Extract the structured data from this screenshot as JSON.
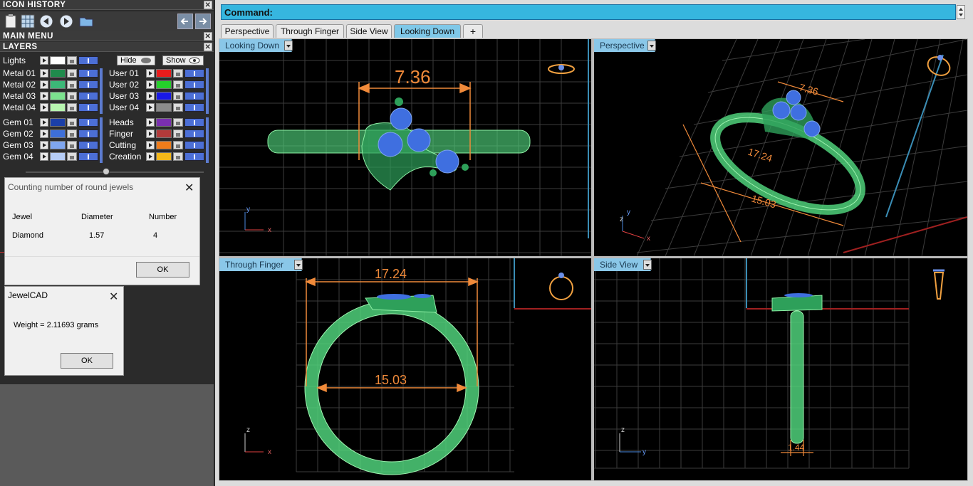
{
  "left_panel": {
    "icon_history_title": "ICON HISTORY",
    "main_menu_title": "MAIN MENU",
    "layers_title": "LAYERS",
    "lights_label": "Lights",
    "hide_label": "Hide",
    "show_label": "Show",
    "metal_layers": [
      {
        "label": "Metal 01",
        "color": "#1f8b4c"
      },
      {
        "label": "Metal 02",
        "color": "#3cb878"
      },
      {
        "label": "Metal 03",
        "color": "#7ce28e"
      },
      {
        "label": "Metal 04",
        "color": "#b8f5b0"
      }
    ],
    "user_layers": [
      {
        "label": "User 01",
        "color": "#e81c1c"
      },
      {
        "label": "User 02",
        "color": "#25d02a"
      },
      {
        "label": "User 03",
        "color": "#1818e8"
      },
      {
        "label": "User 04",
        "color": "#8c8c8c"
      }
    ],
    "gem_layers": [
      {
        "label": "Gem 01",
        "color": "#1b3fa8"
      },
      {
        "label": "Gem 02",
        "color": "#3e6fd8"
      },
      {
        "label": "Gem 03",
        "color": "#7fa6ef"
      },
      {
        "label": "Gem 04",
        "color": "#b6cdf6"
      }
    ],
    "other_layers": [
      {
        "label": "Heads",
        "color": "#7a2fb0"
      },
      {
        "label": "Finger",
        "color": "#b23a3a"
      },
      {
        "label": "Cutting",
        "color": "#f07c1a"
      },
      {
        "label": "Creation",
        "color": "#f4b81a"
      }
    ]
  },
  "jewel_dialog": {
    "title": "Counting number of round jewels",
    "col_jewel": "Jewel",
    "col_diameter": "Diameter",
    "col_number": "Number",
    "row_jewel": "Diamond",
    "row_diameter": "1.57",
    "row_number": "4",
    "ok_label": "OK"
  },
  "weight_dialog": {
    "title": "JewelCAD",
    "message": "Weight = 2.11693 grams",
    "ok_label": "OK"
  },
  "main": {
    "command_label": "Command:",
    "tabs": [
      "Perspective",
      "Through Finger",
      "Side View",
      "Looking Down"
    ],
    "add_tab": "+",
    "viewports": {
      "looking_down": {
        "label": "Looking Down",
        "dimension": "7.36",
        "axis_a": "y",
        "axis_b": "x"
      },
      "perspective": {
        "label": "Perspective",
        "dim_top": "7.36",
        "dim_side": "17.24",
        "dim_bottom": "15.03",
        "axis_a": "y",
        "axis_b": "x",
        "axis_c": "z"
      },
      "through_finger": {
        "label": "Through Finger",
        "dim_outer": "17.24",
        "dim_inner": "15.03",
        "axis_a": "z",
        "axis_b": "x"
      },
      "side_view": {
        "label": "Side View",
        "dimension": "1.44",
        "axis_a": "z",
        "axis_b": "y"
      }
    }
  },
  "colors": {
    "metal_green": "#4fd07a",
    "gem_blue": "#3f6fe0",
    "dimension_orange": "#f08a3a",
    "command_bar": "#36b6df",
    "viewport_label": "#8ac7e8"
  }
}
